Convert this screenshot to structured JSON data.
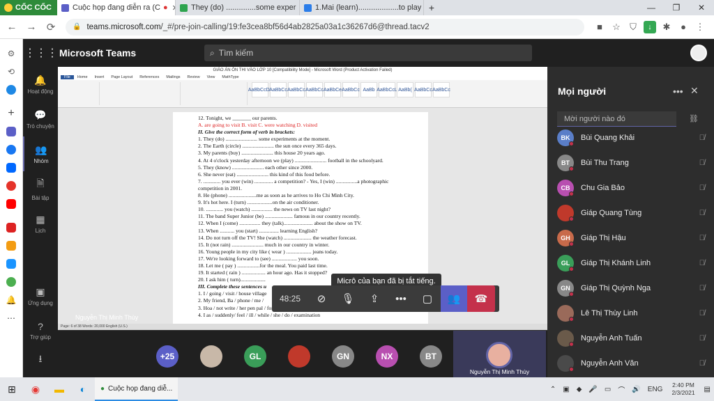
{
  "browser": {
    "brand": "CỐC CỐC",
    "tabs": [
      {
        "title": "Cuộc họp đang diễn ra (C",
        "active": true
      },
      {
        "title": "They (do) ..............some exper",
        "active": false
      },
      {
        "title": "1.Mai (learn)...................to play",
        "active": false
      }
    ],
    "url_host": "teams.microsoft.com",
    "url_path": "/_#/pre-join-calling/19:fe3cea8bf56d4ab2825a03a1c36267d6@thread.tacv2"
  },
  "teams": {
    "app_title": "Microsoft Teams",
    "search_placeholder": "Tìm kiếm",
    "nav": [
      "Hoạt động",
      "Trò chuyện",
      "Nhóm",
      "Bài tập",
      "Lịch"
    ],
    "nav_bottom": [
      "Ứng dụng",
      "Trợ giúp"
    ]
  },
  "word": {
    "window_title": "GIÁO ÁN ÔN THI VÀO LỚP 10 [Compatibility Mode] - Microsoft Word (Product Activation Failed)",
    "tabs": [
      "File",
      "Home",
      "Insert",
      "Page Layout",
      "References",
      "Mailings",
      "Review",
      "View",
      "MathType"
    ],
    "styles": [
      "AaBbCcDc",
      "AaBbCc",
      "AaBbCc",
      "AaBbCc",
      "AaBbCe",
      "AaBbCc",
      "AaBb",
      "AaBbCcL",
      "AaBb(",
      "AaBbCc",
      "AaBbCc"
    ],
    "status": "Page: 6 of 38   Words: 20,000   English (U.S.)",
    "lines": [
      "12. Tonight, we _______ our parents.",
      "A. are going to visit    B. visit        C. were watching      D. visited",
      "II. Give the correct form of verb in brackets:",
      "1. They (do) ........................ some experiments at the moment.",
      "2. The Earth (circle) ........................ the sun once every 365 days.",
      "3. My parents (buy) ........................ this house 20 years ago.",
      "4. At 4 o'clock yesterday afternoon we (play) ........................ football in the schoolyard.",
      "5. They (know) ........................ each other since 2000.",
      "6. She never (eat) ........................ this kind of this food before.",
      "7. ............. you ever (win) .............. a competition? - Yes, I (win) ................a photographic competition in 2001.",
      "8. He (phone) .....................me as soon as he arrives to Ho Chi Minh City.",
      "9. It's hot here. I (turn) ...................on the air conditioner.",
      "10. ............. you (watch) ................ the news on TV last night?",
      "11. The band Super Junior (be) ..................... famous in our country recently.",
      "12. When I (come) ................ they (talk)...................... about the show on TV.",
      "13. When ........... you (start) ............... learning English?",
      "14. Do not turn off the TV! She (watch) ..................... the weather forecast.",
      "15. It (not rain) ........................ much in our country in winter.",
      "16. Young people in my city like ( wear ) ................... jeans today.",
      "17. We're looking forward to (see) ................... you soon.",
      "18. Let me ( pay ) .................for the meal. You paid last time.",
      "19. It started ( rain ) .................. an hour ago. Has it stopped?",
      "20. I ask him ( turn)...................",
      "III. Complete these sentences u",
      "1. I / going / visit / house village",
      "2. My friend, Ba / phone / me /",
      "3. Hoa / not write / her pen pal / for three years.",
      "4. I as / suddenly/ feel / ill / while / she / do / examination"
    ]
  },
  "meeting": {
    "timer": "48:25",
    "toast": "Micrô của bạn đã bị tắt tiếng.",
    "presenter_name": "Nguyễn Thị Minh Thùy",
    "overflow_count": "+25",
    "gallery": [
      {
        "initials": "",
        "color": "#c8b8a8"
      },
      {
        "initials": "GL",
        "color": "#3a9e59"
      },
      {
        "initials": "",
        "color": "#c0392b"
      },
      {
        "initials": "GN",
        "color": "#888888"
      },
      {
        "initials": "NX",
        "color": "#b84fb0"
      },
      {
        "initials": "BT",
        "color": "#888888"
      }
    ],
    "tile_name": "Nguyễn Thị Minh Thùy"
  },
  "people": {
    "title": "Mọi người",
    "invite_placeholder": "Mời người nào đó",
    "list": [
      {
        "initials": "BK",
        "color": "#5a7ec8",
        "name": "Bùi Quang Khải"
      },
      {
        "initials": "BT",
        "color": "#888888",
        "name": "Bùi Thu Trang"
      },
      {
        "initials": "CB",
        "color": "#b84fb0",
        "name": "Chu Gia Bảo"
      },
      {
        "initials": "",
        "color": "#c0392b",
        "name": "Giáp Quang Tùng"
      },
      {
        "initials": "GH",
        "color": "#c86a4a",
        "name": "Giáp Thị Hậu"
      },
      {
        "initials": "GL",
        "color": "#3a9e59",
        "name": "Giáp Thị Khánh Linh"
      },
      {
        "initials": "GN",
        "color": "#888888",
        "name": "Giáp Thị Quỳnh Nga"
      },
      {
        "initials": "",
        "color": "#9a6a5a",
        "name": "Lê Thị Thùy Linh"
      },
      {
        "initials": "",
        "color": "#6a5a4a",
        "name": "Nguyễn Anh Tuấn"
      },
      {
        "initials": "",
        "color": "#4a4a4a",
        "name": "Nguyễn Anh Văn"
      }
    ]
  },
  "taskbar": {
    "app": "Cuộc họp đang diễ...",
    "lang": "ENG",
    "time": "2:40 PM",
    "date": "2/3/2021"
  }
}
